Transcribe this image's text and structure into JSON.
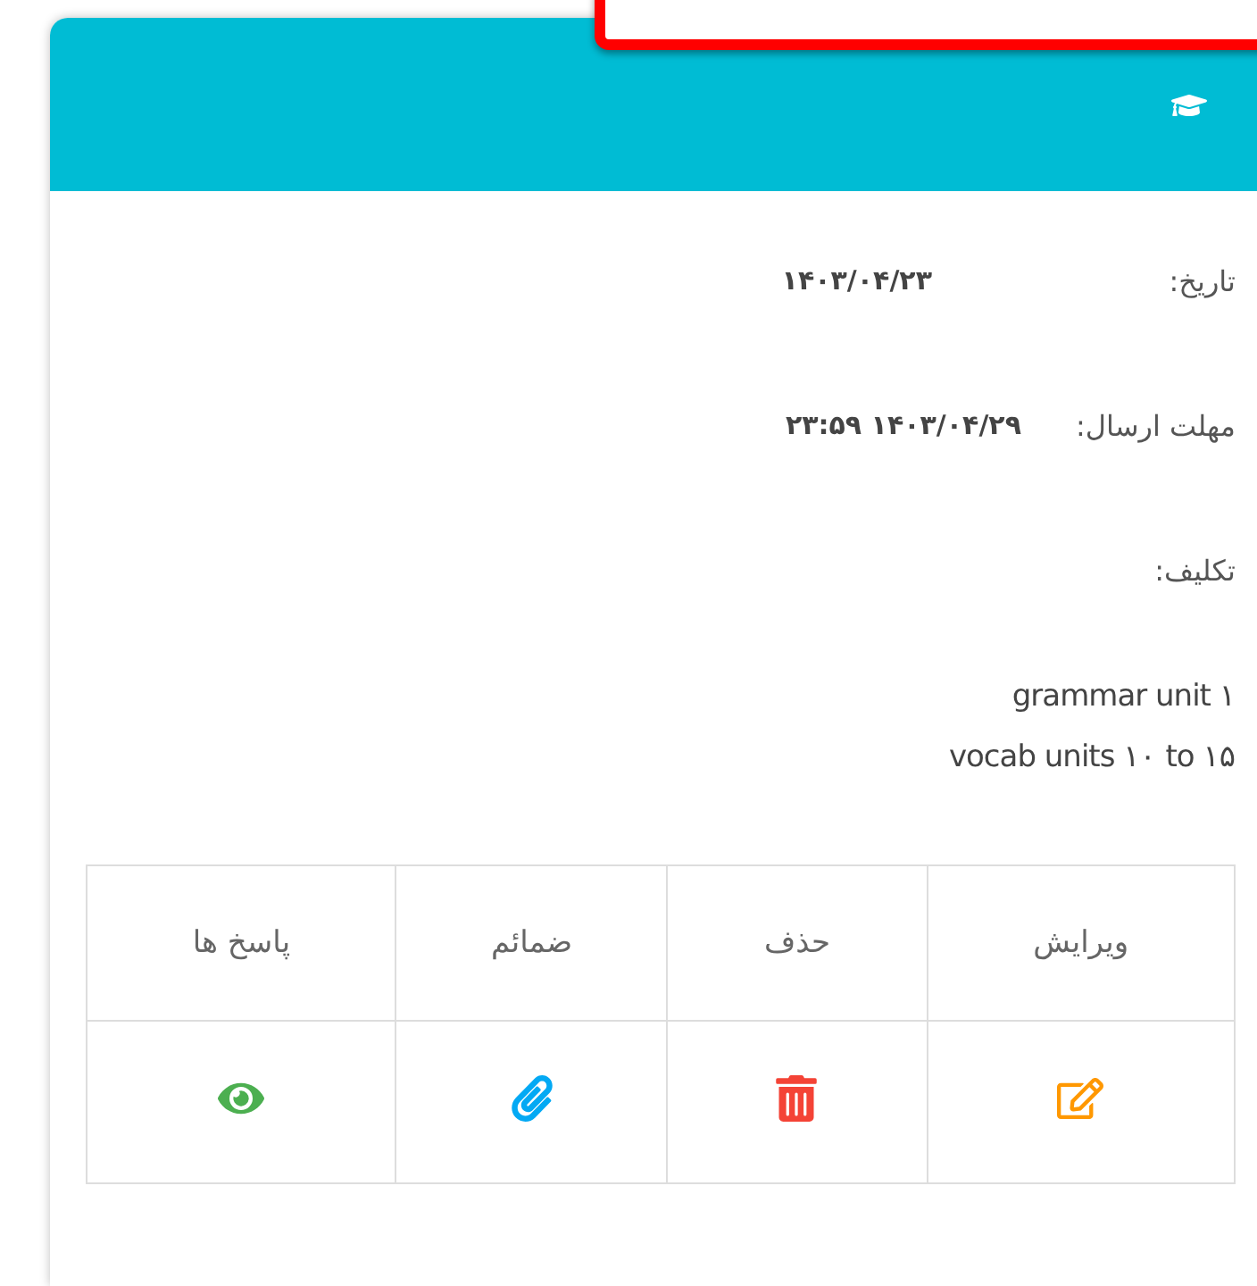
{
  "card": {
    "fields": [
      {
        "label": "تاریخ:",
        "value": "۱۴۰۳/۰۴/۲۳"
      },
      {
        "label": "مهلت ارسال:",
        "value": "۱۴۰۳/۰۴/۲۹ ۲۳:۵۹"
      }
    ],
    "assignment": {
      "label": "تکلیف:",
      "lines": [
        "grammar unit ۱",
        "vocab units ۱۰ to ۱۵"
      ]
    },
    "actions": [
      {
        "kind": "edit",
        "label": "ویرایش"
      },
      {
        "kind": "delete",
        "label": "حذف"
      },
      {
        "kind": "attachments",
        "label": "ضمائم"
      },
      {
        "kind": "responses",
        "label": "پاسخ ها"
      }
    ]
  }
}
